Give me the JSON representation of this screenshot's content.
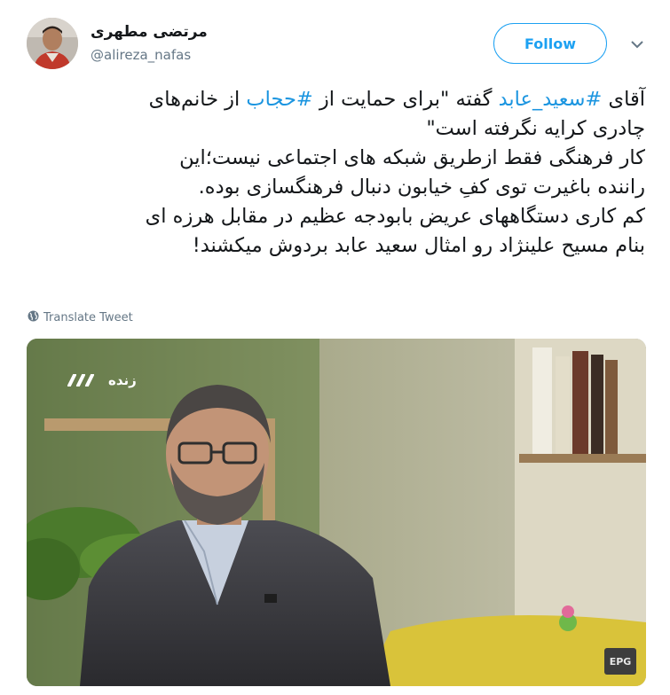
{
  "author": {
    "display_name": "مرتضی مطهری",
    "handle": "@alireza_nafas"
  },
  "follow_label": "Follow",
  "tweet": {
    "lines": [
      {
        "pre": "آقای ",
        "tag1": "#سعید_عابد",
        "mid": " گفته \"برای حمایت از ",
        "tag2": "#حجاب",
        "post": " از خانم‌های"
      },
      "چادری کرایه نگرفته است\"",
      "کار فرهنگی فقط ازطریق شبکه های اجتماعی نیست؛این",
      "راننده باغیرت توی کفِ خیابون دنبال فرهنگسازی بوده.",
      "کم کاری دستگاههای عریض بابودجه عظیم در مقابل هرزه ای",
      "بنام مسیح علینژاد رو امثال سعید عابد بردوش میکشند!"
    ]
  },
  "translate_label": "Translate Tweet",
  "media": {
    "live_label": "زنده",
    "epg_label": "EPG"
  },
  "icons": {
    "caret": "chevron-down-icon",
    "translate": "globe-icon"
  },
  "colors": {
    "accent": "#1da1f2",
    "hashtag": "#1b95e0",
    "muted": "#657786",
    "text": "#14171a"
  }
}
